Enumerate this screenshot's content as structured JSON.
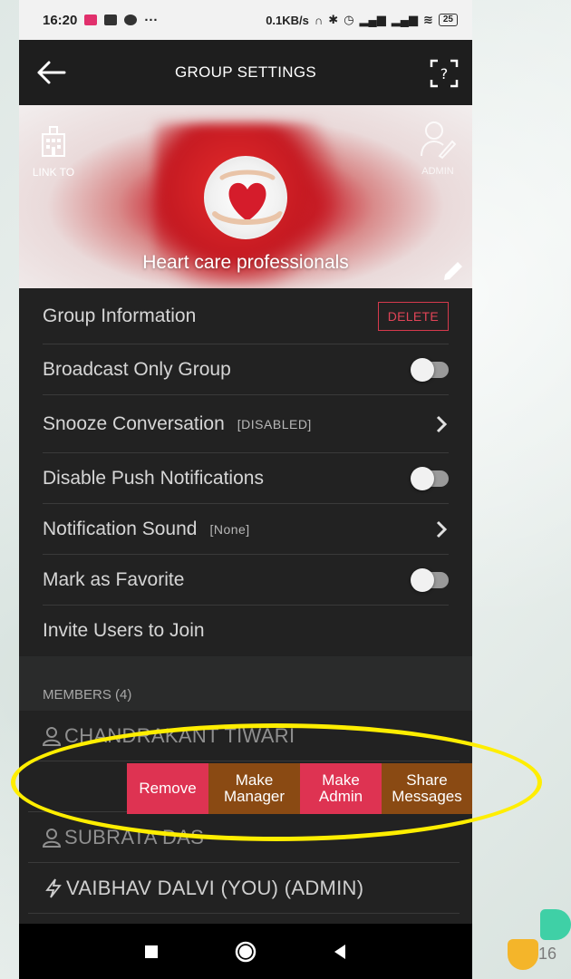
{
  "status_bar": {
    "time": "16:20",
    "dots": "···",
    "network_speed": "0.1KB/s",
    "battery": "25"
  },
  "app_bar": {
    "title": "GROUP SETTINGS"
  },
  "banner": {
    "link_to_label": "LINK TO",
    "admin_label": "ADMIN",
    "group_name": "Heart care professionals"
  },
  "settings": {
    "group_information": "Group Information",
    "delete_label": "DELETE",
    "broadcast_only": "Broadcast Only Group",
    "snooze": "Snooze Conversation",
    "snooze_tag": "[DISABLED]",
    "disable_push": "Disable Push Notifications",
    "notification_sound": "Notification Sound",
    "notification_sound_tag": "[None]",
    "mark_favorite": "Mark as Favorite",
    "invite_users": "Invite Users to Join"
  },
  "members": {
    "header": "MEMBERS (4)",
    "list": [
      "CHANDRAKANT TIWARI",
      "SUBRATA DAS",
      "VAIBHAV  DALVI  (YOU)  (ADMIN)"
    ],
    "actions": {
      "remove": "Remove",
      "make_manager_1": "Make",
      "make_manager_2": "Manager",
      "make_admin_1": "Make",
      "make_admin_2": "Admin",
      "share_messages_1": "Share",
      "share_messages_2": "Messages"
    }
  },
  "decoration": {
    "number": "16"
  },
  "colors": {
    "accent_red": "#de3352",
    "accent_brown": "#8a4a13",
    "highlight": "#ffee00"
  }
}
